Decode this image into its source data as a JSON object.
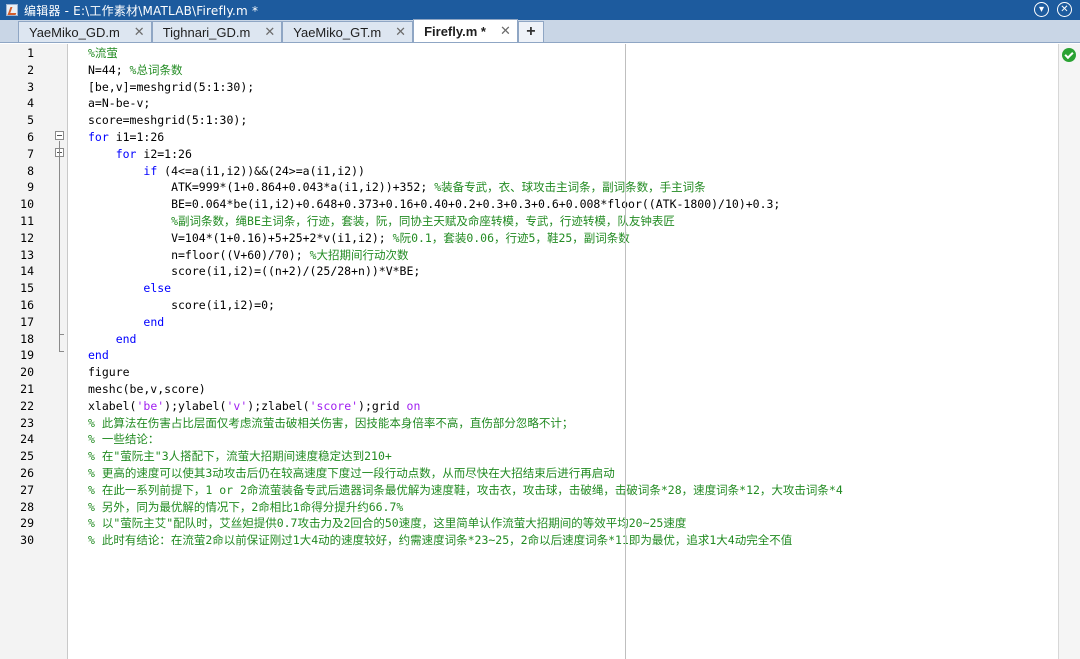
{
  "window": {
    "title": "编辑器 - E:\\工作素材\\MATLAB\\Firefly.m *"
  },
  "tabs": [
    {
      "label": "YaeMiko_GD.m",
      "close": "✕"
    },
    {
      "label": "Tighnari_GD.m",
      "close": "✕"
    },
    {
      "label": "YaeMiko_GT.m",
      "close": "✕"
    },
    {
      "label": "Firefly.m *",
      "close": "✕",
      "active": true
    }
  ],
  "tab_add_label": "+",
  "status": {
    "icon": "check-circle-icon",
    "color": "#2aa233"
  },
  "colors": {
    "keyword": "#0000ff",
    "comment": "#228b22",
    "string": "#a020f0",
    "titlebar": "#1d5b9e"
  },
  "code_lines": [
    [
      [
        "cm",
        "%流萤"
      ]
    ],
    [
      [
        "tx",
        "N=44; "
      ],
      [
        "cm",
        "%总词条数"
      ]
    ],
    [
      [
        "tx",
        "[be,v]=meshgrid(5:1:30);"
      ]
    ],
    [
      [
        "tx",
        "a=N-be-v;"
      ]
    ],
    [
      [
        "tx",
        "score=meshgrid(5:1:30);"
      ]
    ],
    [
      [
        "kw",
        "for"
      ],
      [
        "tx",
        " i1=1:26"
      ]
    ],
    [
      [
        "tx",
        "    "
      ],
      [
        "kw",
        "for"
      ],
      [
        "tx",
        " i2=1:26"
      ]
    ],
    [
      [
        "tx",
        "        "
      ],
      [
        "kw",
        "if"
      ],
      [
        "tx",
        " (4<=a(i1,i2))&&(24>=a(i1,i2))"
      ]
    ],
    [
      [
        "tx",
        "            ATK=999*(1+0.864+0.043*a(i1,i2))+352; "
      ],
      [
        "cm",
        "%装备专武，衣、球攻击主词条，副词条数，手主词条"
      ]
    ],
    [
      [
        "tx",
        "            BE=0.064*be(i1,i2)+0.648+0.373+0.16+0.40+0.2+0.3+0.3+0.6+0.008*floor((ATK-1800)/10)+0.3;"
      ]
    ],
    [
      [
        "tx",
        "            "
      ],
      [
        "cm",
        "%副词条数，绳BE主词条，行迹，套装，阮，同协主天赋及命座转模，专武，行迹转模，队友钟表匠"
      ]
    ],
    [
      [
        "tx",
        "            V=104*(1+0.16)+5+25+2*v(i1,i2); "
      ],
      [
        "cm",
        "%阮0.1，套装0.06，行迹5，鞋25，副词条数"
      ]
    ],
    [
      [
        "tx",
        "            n=floor((V+60)/70); "
      ],
      [
        "cm",
        "%大招期间行动次数"
      ]
    ],
    [
      [
        "tx",
        "            score(i1,i2)=((n+2)/(25/28+n))*V*BE;"
      ]
    ],
    [
      [
        "tx",
        "        "
      ],
      [
        "kw",
        "else"
      ]
    ],
    [
      [
        "tx",
        "            score(i1,i2)=0;"
      ]
    ],
    [
      [
        "tx",
        "        "
      ],
      [
        "kw",
        "end"
      ]
    ],
    [
      [
        "tx",
        "    "
      ],
      [
        "kw",
        "end"
      ]
    ],
    [
      [
        "kw",
        "end"
      ]
    ],
    [
      [
        "tx",
        "figure"
      ]
    ],
    [
      [
        "tx",
        "meshc(be,v,score)"
      ]
    ],
    [
      [
        "tx",
        "xlabel("
      ],
      [
        "st",
        "'be'"
      ],
      [
        "tx",
        ");ylabel("
      ],
      [
        "st",
        "'v'"
      ],
      [
        "tx",
        ");zlabel("
      ],
      [
        "st",
        "'score'"
      ],
      [
        "tx",
        ");grid "
      ],
      [
        "st",
        "on"
      ]
    ],
    [
      [
        "cm",
        "% 此算法在伤害占比层面仅考虑流萤击破相关伤害，因技能本身倍率不高，直伤部分忽略不计；"
      ]
    ],
    [
      [
        "cm",
        "% 一些结论："
      ]
    ],
    [
      [
        "cm",
        "% 在\"萤阮主\"3人搭配下，流萤大招期间速度稳定达到210+"
      ]
    ],
    [
      [
        "cm",
        "% 更高的速度可以使其3动攻击后仍在较高速度下度过一段行动点数，从而尽快在大招结束后进行再启动"
      ]
    ],
    [
      [
        "cm",
        "% 在此一系列前提下，1 or 2命流萤装备专武后遗器词条最优解为速度鞋，攻击衣，攻击球，击破绳，击破词条*28，速度词条*12，大攻击词条*4"
      ]
    ],
    [
      [
        "cm",
        "% 另外，同为最优解的情况下，2命相比1命得分提升约66.7%"
      ]
    ],
    [
      [
        "cm",
        "% 以\"萤阮主艾\"配队时，艾丝妲提供0.7攻击力及2回合的50速度，这里简单认作流萤大招期间的等效平均20~25速度"
      ]
    ],
    [
      [
        "cm",
        "% 此时有结论：在流萤2命以前保证刚过1大4动的速度较好，约需速度词条*23~25，2命以后速度词条*11即为最优，追求1大4动完全不值"
      ]
    ]
  ]
}
